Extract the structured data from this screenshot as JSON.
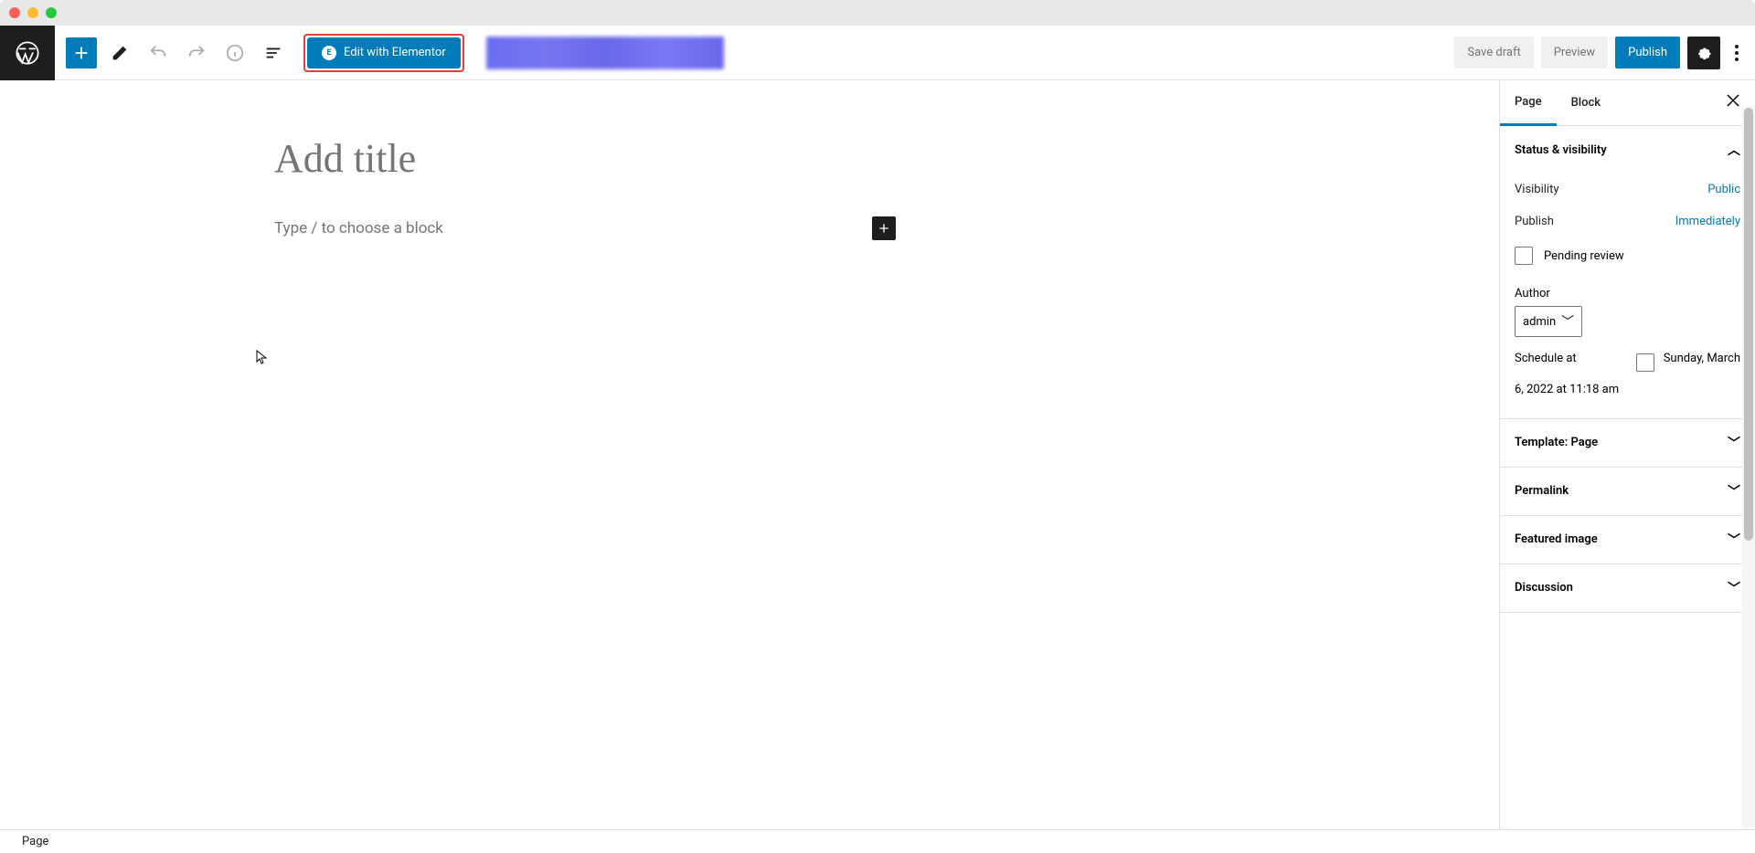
{
  "toolbar": {
    "elementor_label": "Edit with Elementor",
    "save_draft": "Save draft",
    "preview": "Preview",
    "publish": "Publish"
  },
  "editor": {
    "title_placeholder": "Add title",
    "block_placeholder": "Type / to choose a block"
  },
  "sidebar": {
    "tabs": {
      "page": "Page",
      "block": "Block"
    },
    "sections": {
      "status": {
        "title": "Status & visibility",
        "visibility_label": "Visibility",
        "visibility_value": "Public",
        "publish_label": "Publish",
        "publish_value": "Immediately",
        "pending_review": "Pending review",
        "author_label": "Author",
        "author_value": "admin",
        "schedule_label": "Schedule at",
        "schedule_right": "Sunday, March",
        "schedule_line2": "6, 2022 at 11:18 am"
      },
      "template": "Template: Page",
      "permalink": "Permalink",
      "featured_image": "Featured image",
      "discussion": "Discussion"
    }
  },
  "footer": {
    "breadcrumb": "Page"
  }
}
